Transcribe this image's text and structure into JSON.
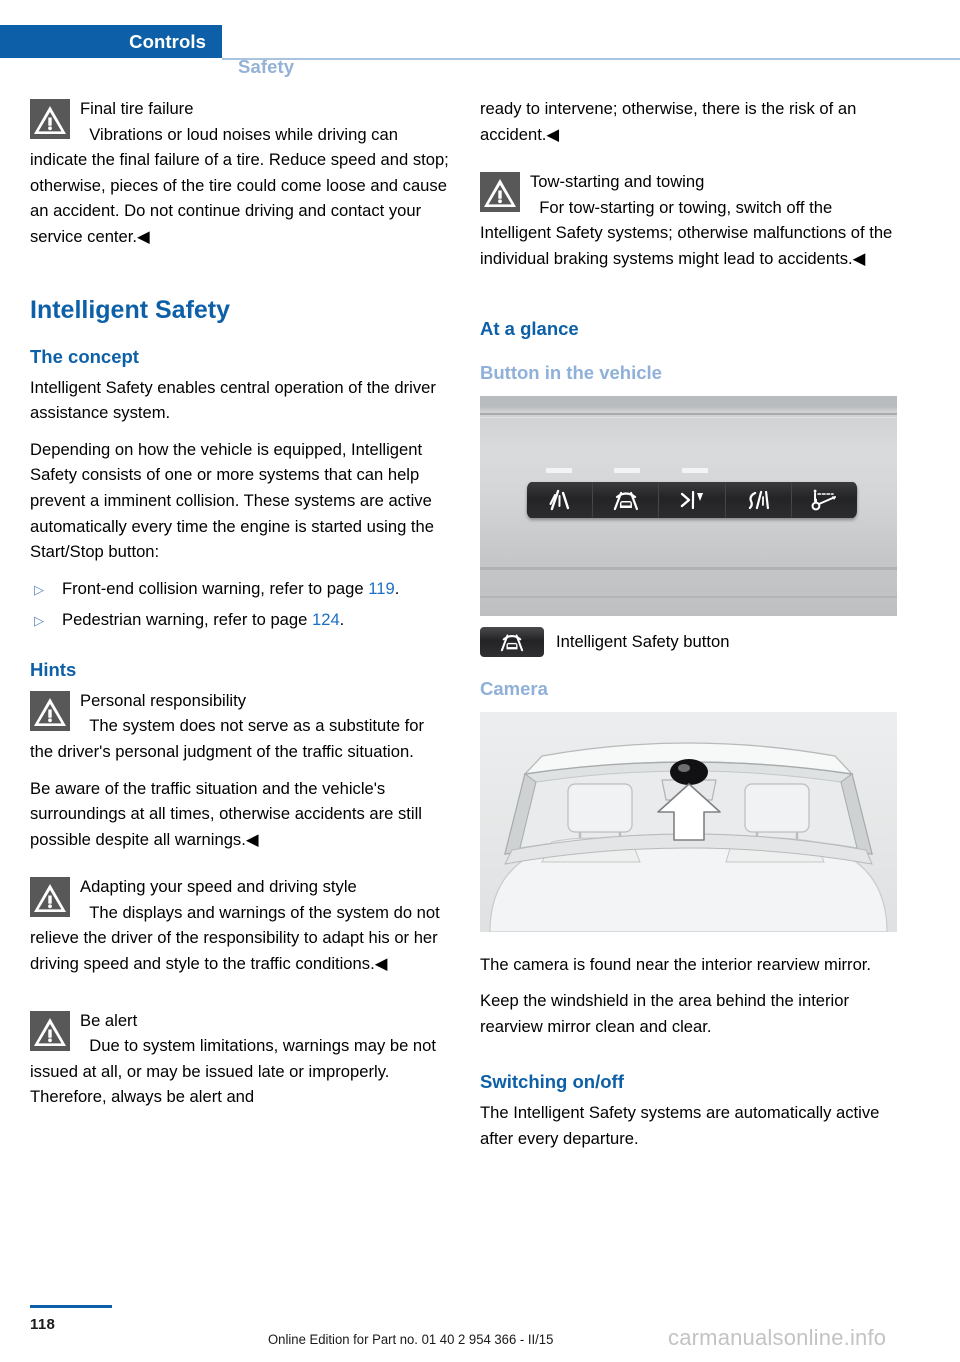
{
  "header": {
    "active_tab": "Controls",
    "inactive_tab": "Safety"
  },
  "left_column": {
    "warning_final_tire": {
      "icon": "warning-triangle-icon",
      "title": "Final tire failure",
      "text": "Vibrations or loud noises while driving can indicate the final failure of a tire. Reduce speed and stop; otherwise, pieces of the tire could come loose and cause an accident. Do not continue driving and contact your service center.",
      "endmark": "◀"
    },
    "section_title": "Intelligent Safety",
    "concept_heading": "The concept",
    "concept_paragraph_1": "Intelligent Safety enables central operation of the driver assistance system.",
    "concept_paragraph_2": "Depending on how the vehicle is equipped, Intelligent Safety consists of one or more systems that can help prevent a imminent collision. These systems are active automatically every time the engine is started using the Start/Stop button:",
    "bullets": [
      {
        "marker": "▷",
        "text_before": "Front-end collision warning, refer to page ",
        "page": "119",
        "text_after": "."
      },
      {
        "marker": "▷",
        "text_before": "Pedestrian warning, refer to page ",
        "page": "124",
        "text_after": "."
      }
    ],
    "hints_heading": "Hints",
    "warning_personal": {
      "icon": "warning-triangle-icon",
      "title": "Personal responsibility",
      "text": "The system does not serve as a substitute for the driver's personal judgment of the traffic situation."
    },
    "personal_followup": "Be aware of the traffic situation and the vehicle's surroundings at all times, otherwise accidents are still possible despite all warnings.",
    "personal_followup_endmark": "◀",
    "warning_adapting": {
      "icon": "warning-triangle-icon",
      "title": "Adapting your speed and driving style",
      "text": "The displays and warnings of the system do not relieve the driver of the responsibility to adapt his or her driving speed and style to the traffic conditions.",
      "endmark": "◀"
    },
    "warning_be_alert": {
      "icon": "warning-triangle-icon",
      "title": "Be alert",
      "text": "Due to system limitations, warnings may be not issued at all, or may be issued late or improperly. Therefore, always be alert and"
    }
  },
  "right_column": {
    "continued_paragraph": "ready to intervene; otherwise, there is the risk of an accident.",
    "continued_endmark": "◀",
    "warning_tow": {
      "icon": "warning-triangle-icon",
      "title": "Tow-starting and towing",
      "text": "For tow-starting or towing, switch off the Intelligent Safety systems; otherwise malfunctions of the individual braking systems might lead to accidents.",
      "endmark": "◀"
    },
    "at_a_glance_heading": "At a glance",
    "button_in_vehicle_heading": "Button in the vehicle",
    "figure_buttons": {
      "name": "dashboard-button-panel-photo",
      "keys": [
        "lane-departure-warning-icon",
        "intelligent-safety-icon",
        "lane-change-warning-icon",
        "active-lane-keeping-icon",
        "head-up-display-icon"
      ]
    },
    "button_legend": {
      "icon": "intelligent-safety-icon",
      "label": "Intelligent Safety button"
    },
    "camera_heading": "Camera",
    "figure_camera": {
      "name": "windshield-camera-photo",
      "callout": "arrow-up-icon"
    },
    "camera_paragraph_1": "The camera is found near the interior rearview mirror.",
    "camera_paragraph_2": "Keep the windshield in the area behind the interior rearview mirror clean and clear.",
    "switching_heading": "Switching on/off",
    "switching_paragraph": "The Intelligent Safety systems are automatically active after every departure."
  },
  "footer": {
    "page_number": "118",
    "edition": "Online Edition for Part no. 01 40 2 954 366 - II/15",
    "watermark": "carmanualsonline.info"
  },
  "colors": {
    "brand_blue": "#0d60a8",
    "light_blue": "#8fb0d8",
    "link_blue": "#1b6fc4",
    "warning_gray": "#585858"
  }
}
